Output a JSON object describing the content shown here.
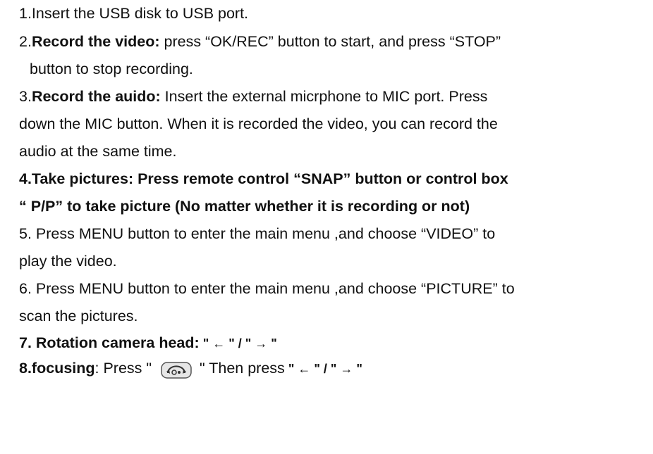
{
  "instructions": {
    "l1": "1.Insert the USB disk to USB port.",
    "l2_prefix": "2.",
    "l2_bold": "Record the video:",
    "l2_rest": " press “OK/REC” button to start, and press “STOP”",
    "l2_cont": "button to stop recording.",
    "l3_prefix": "3.",
    "l3_bold": "Record the auido:",
    "l3_rest": " Insert the external micrphone to MIC port. Press",
    "l3_cont1": "down the MIC button. When it is recorded the video, you can record the",
    "l3_cont2": "audio at the same time.",
    "l4": "4.Take pictures: Press remote control “SNAP” button or control box",
    "l4_cont": "“ P/P” to take picture (No matter whether it is recording or not)",
    "l5": "5. Press MENU button to enter the main menu ,and choose “VIDEO” to",
    "l5_cont": "play the video.",
    "l6": "6. Press MENU button to enter the main menu ,and choose “PICTURE” to",
    "l6_cont": "scan the pictures.",
    "l7_bold": "7. Rotation camera head:",
    "l7_rest": " \" ← \" / \" → \"",
    "l8_bold": "8.focusing",
    "l8_a": ": Press \"",
    "l8_b": "\" Then press",
    "l8_c": "  \" ← \" / \" → \""
  },
  "icons": {
    "focus": "focus-button-icon"
  }
}
